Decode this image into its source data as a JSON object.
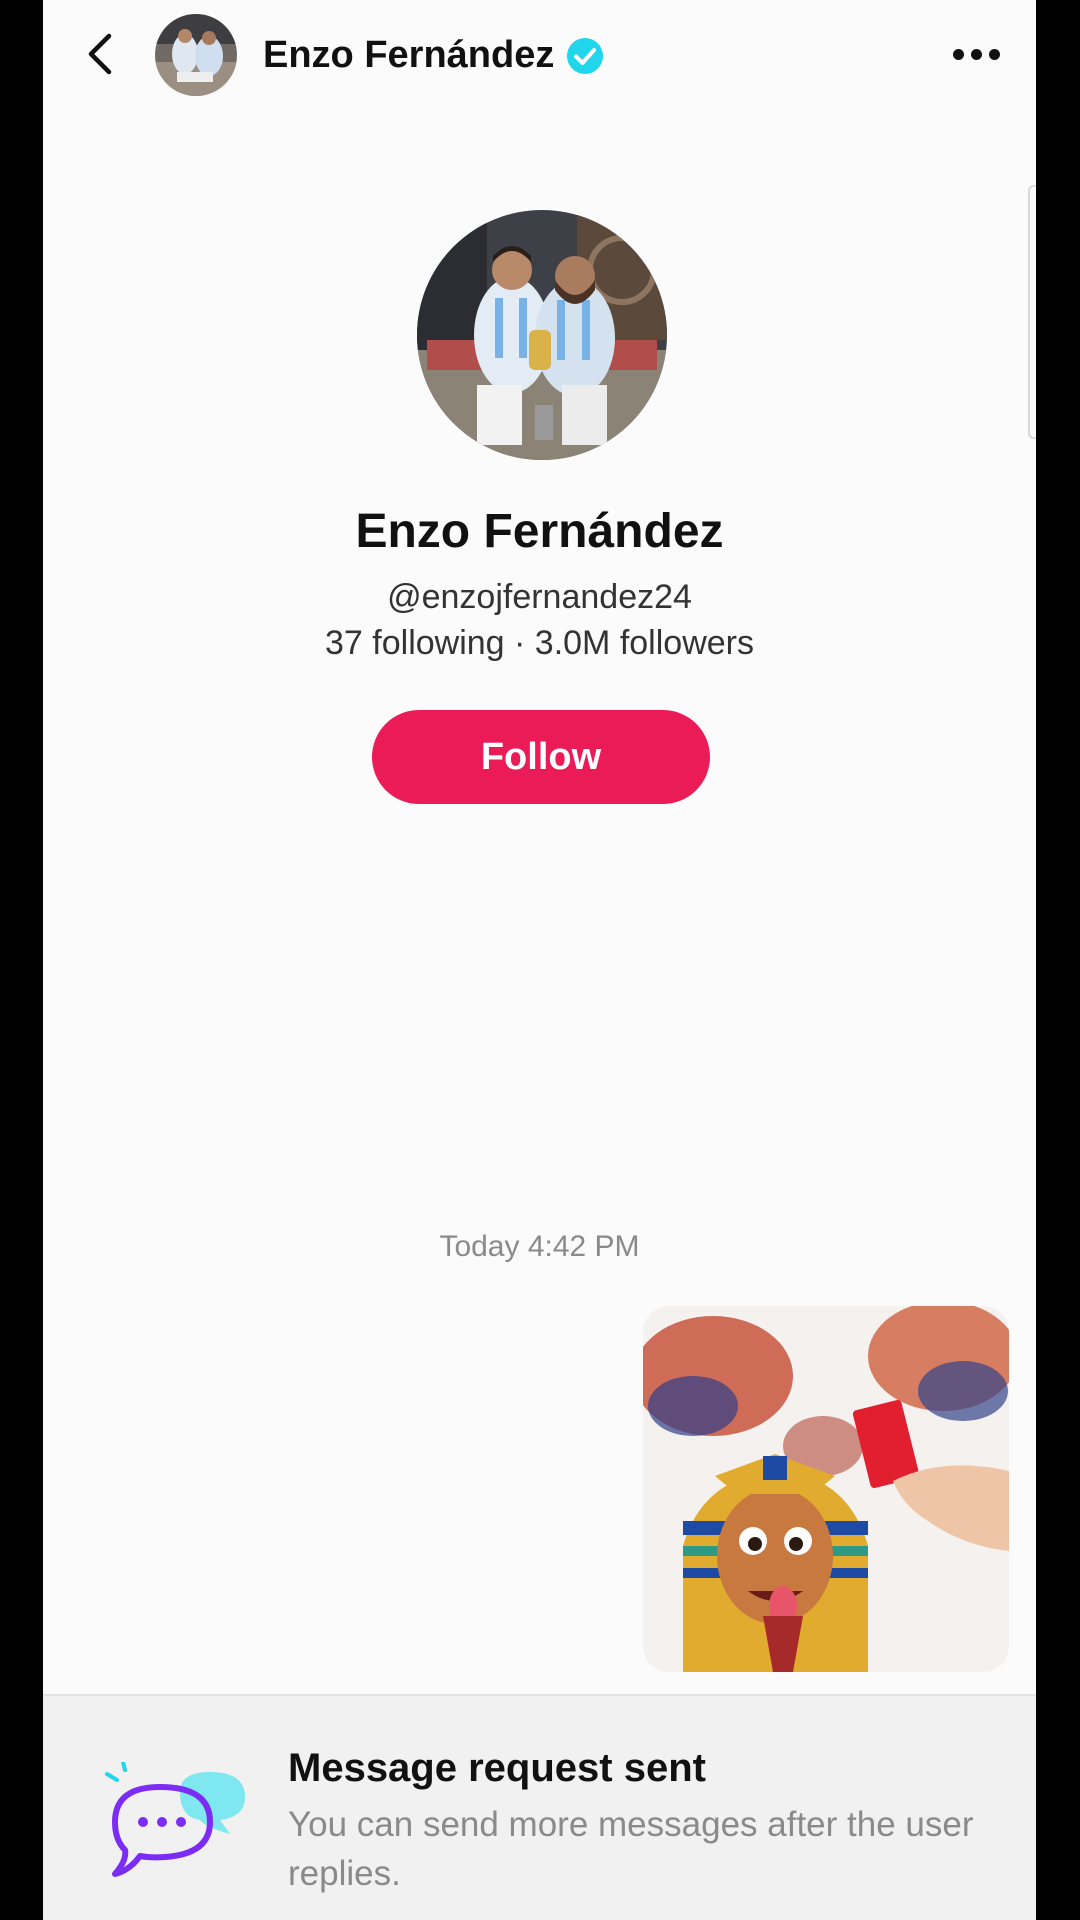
{
  "header": {
    "name": "Enzo Fernández",
    "back_icon": "chevron-left-icon",
    "verified_icon": "verified-badge-icon",
    "more_icon": "more-horizontal-icon"
  },
  "profile": {
    "name": "Enzo Fernández",
    "handle": "@enzojfernandez24",
    "stats": "37 following · 3.0M followers",
    "follow_label": "Follow"
  },
  "conversation": {
    "timestamp": "Today 4:42 PM"
  },
  "banner": {
    "title": "Message request sent",
    "text": "You can send more messages after the user replies."
  },
  "colors": {
    "follow_button": "#ea1b57",
    "verified": "#20d5ec",
    "icon_purple": "#7b2cf5",
    "icon_cyan": "#7fe7ef"
  }
}
